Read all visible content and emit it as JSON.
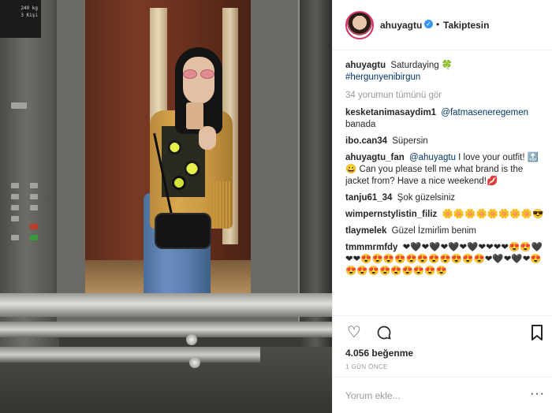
{
  "photo": {
    "alt": "",
    "panel_display": [
      "240 kg",
      "3 Kişi"
    ]
  },
  "header": {
    "username": "ahuyagtu",
    "verified_icon": "verified-badge-icon",
    "separator": "•",
    "follow_status": "Takiptesin"
  },
  "caption": {
    "username": "ahuyagtu",
    "text": "Saturdaying 🍀",
    "hashtag": "#hergunyenibirgun"
  },
  "view_all_comments": "34 yorumun tümünü gör",
  "comments": [
    {
      "username": "kesketanimasaydim1",
      "mention": "@fatmaseneregemen",
      "text": "banada"
    },
    {
      "username": "ibo.can34",
      "mention": "",
      "text": "Süpersin"
    },
    {
      "username": "ahuyagtu_fan",
      "mention": "@ahuyagtu",
      "text": "I love your outfit! 🔝😀 Can you please tell me what brand is the jacket from? Have a nice weekend!💋"
    },
    {
      "username": "tanju61_34",
      "mention": "",
      "text": "Şok güzelsiniz"
    },
    {
      "username": "wimpernstylistin_filiz",
      "mention": "",
      "text": "🌼🌼🌼🌼🌼🌼🌼🌼😎"
    },
    {
      "username": "tlaymelek",
      "mention": "",
      "text": "Güzel İzmirlim benim"
    },
    {
      "username": "tmmmrmfdy",
      "mention": "",
      "text": "❤🖤❤🖤❤🖤❤🖤❤❤❤❤😍😍🖤❤❤😍😍😍😍😍😍😍😍😍😍😍❤🖤❤🖤❤😍😍😍😍😍😍😍😍😍😍"
    }
  ],
  "actions": {
    "like_icon": "heart-icon",
    "comment_icon": "comment-icon",
    "save_icon": "bookmark-icon"
  },
  "likes": "4.056 beğenme",
  "timestamp": "1 GÜN ÖNCE",
  "add_comment": {
    "placeholder": "Yorum ekle...",
    "more": "···"
  },
  "colors": {
    "link": "#003569",
    "muted": "#999999",
    "text": "#262626",
    "verified": "#3897f0",
    "border": "#efefef"
  }
}
